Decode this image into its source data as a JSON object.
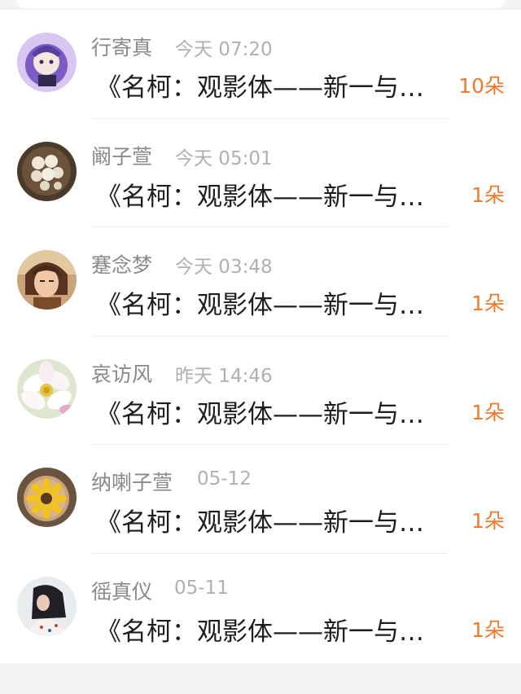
{
  "rows": [
    {
      "name": "行寄真",
      "time": "今天 07:20",
      "title": "《名柯：观影体——新一与柯南》",
      "count": "10朵",
      "avatar": "anime-purple-avatar"
    },
    {
      "name": "阚子萱",
      "time": "今天 05:01",
      "title": "《名柯：观影体——新一与柯南》",
      "count": "1朵",
      "avatar": "pearls-avatar"
    },
    {
      "name": "蹇念梦",
      "time": "今天 03:48",
      "title": "《名柯：观影体——新一与柯南》",
      "count": "1朵",
      "avatar": "anime-man-avatar"
    },
    {
      "name": "哀访风",
      "time": "昨天 14:46",
      "title": "《名柯：观影体——新一与柯南》",
      "count": "1朵",
      "avatar": "cosmos-flower-avatar"
    },
    {
      "name": "纳喇子萱",
      "time": "05-12",
      "title": "《名柯：观影体——新一与柯南》",
      "count": "1朵",
      "avatar": "sunflower-avatar"
    },
    {
      "name": "徭真仪",
      "time": "05-11",
      "title": "《名柯：观影体——新一与柯南》",
      "count": "1朵",
      "avatar": "girl-photo-avatar"
    }
  ],
  "colors": {
    "accent": "#f07a2a",
    "name": "#8a8a8a",
    "time": "#b0b0b0",
    "title": "#1e1e1e"
  }
}
